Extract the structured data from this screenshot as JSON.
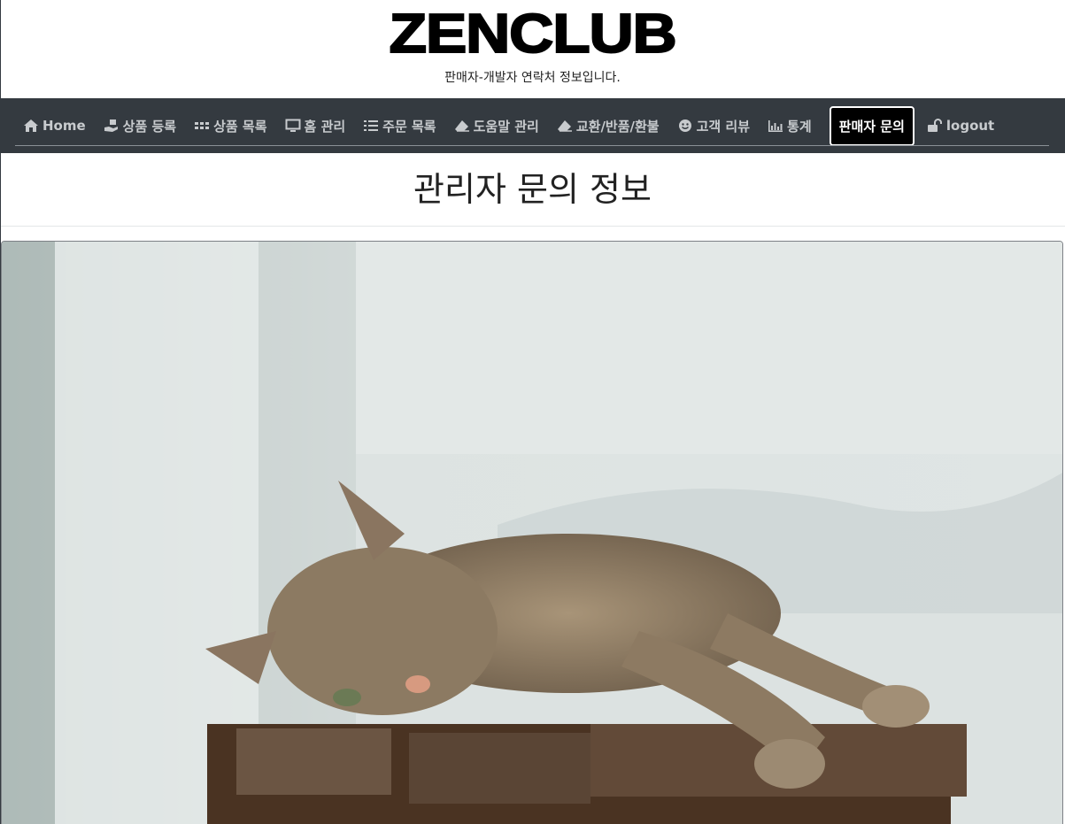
{
  "brand": {
    "logo": "ZENCLUB",
    "subtitle": "판매자-개발자 연락처 정보입니다."
  },
  "nav": {
    "items": [
      {
        "label": "Home",
        "icon": "home-icon"
      },
      {
        "label": "상품 등록",
        "icon": "hand-box-icon"
      },
      {
        "label": "상품 목록",
        "icon": "grid-icon"
      },
      {
        "label": "홈 관리",
        "icon": "monitor-icon"
      },
      {
        "label": "주문 목록",
        "icon": "list-icon"
      },
      {
        "label": "도움말 관리",
        "icon": "eraser-icon"
      },
      {
        "label": "교환/반품/환불",
        "icon": "eraser-icon"
      },
      {
        "label": "고객 리뷰",
        "icon": "smile-icon"
      },
      {
        "label": "통계",
        "icon": "chart-icon"
      },
      {
        "label": "판매자 문의",
        "icon": "",
        "active": true
      },
      {
        "label": "logout",
        "icon": "unlock-icon"
      }
    ]
  },
  "main": {
    "title": "관리자 문의 정보",
    "image_subject": "cat-photo"
  },
  "colors": {
    "navbar": "#343a40",
    "nav_text": "#c8cbce",
    "active_bg": "#000000",
    "active_text": "#ffffff"
  }
}
